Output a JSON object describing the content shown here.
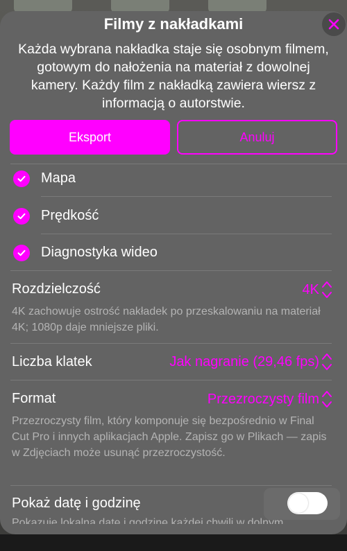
{
  "sheet": {
    "title": "Filmy z nakładkami",
    "description": "Każda wybrana nakładka staje się osobnym filmem, gotowym do nałożenia na materiał z dowolnej kamery. Każdy film z nakładką zawiera wiersz z informacją o autorstwie.",
    "close_icon": "close-x-icon"
  },
  "buttons": {
    "export_label": "Eksport",
    "cancel_label": "Anuluj"
  },
  "overlays": [
    {
      "label": "Mapa",
      "checked": true
    },
    {
      "label": "Prędkość",
      "checked": true
    },
    {
      "label": "Diagnostyka wideo",
      "checked": true
    }
  ],
  "settings": {
    "resolution": {
      "label": "Rozdzielczość",
      "value": "4K",
      "help": "4K zachowuje ostrość nakładek po przeskalowaniu na materiał 4K; 1080p daje mniejsze pliki."
    },
    "frame_rate": {
      "label": "Liczba klatek",
      "value": "Jak nagranie (29,46 fps)"
    },
    "format": {
      "label": "Format",
      "value": "Przezroczysty film",
      "help": "Przezroczysty film, który komponuje się bezpośrednio w Final Cut Pro i innych aplikacjach Apple. Zapisz go w Plikach — zapis w Zdjęciach może usunąć przezroczystość."
    },
    "show_datetime": {
      "label": "Pokaż datę i godzinę",
      "enabled": false,
      "help": "Pokazuje lokalną datę i godzinę każdej chwili w dolnym"
    }
  },
  "colors": {
    "accent": "#ff00ff",
    "sheet": "#636363",
    "help_text": "#b4b4b4"
  }
}
